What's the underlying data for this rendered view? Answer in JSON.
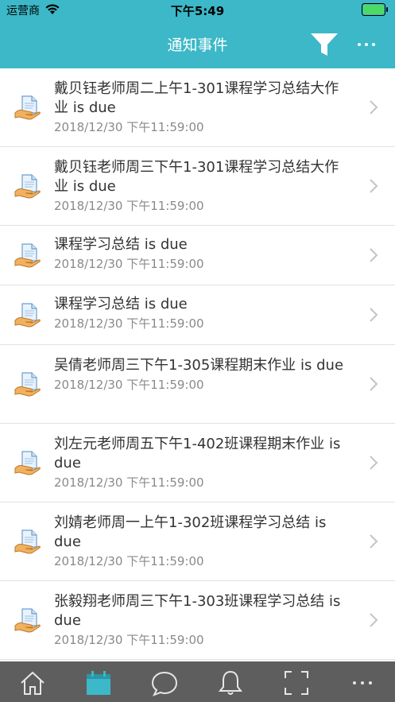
{
  "status_bar": {
    "carrier": "运营商",
    "time": "下午5:49",
    "battery_color": "#4cd964"
  },
  "nav": {
    "title": "通知事件",
    "background": "#3cb8c8"
  },
  "events": [
    {
      "title": "戴贝钰老师周二上午1-301课程学习总结大作业 is due",
      "date": "2018/12/30 下午11:59:00"
    },
    {
      "title": "戴贝钰老师周三下午1-301课程学习总结大作业 is due",
      "date": "2018/12/30 下午11:59:00"
    },
    {
      "title": "课程学习总结 is due",
      "date": "2018/12/30 下午11:59:00"
    },
    {
      "title": "课程学习总结 is due",
      "date": "2018/12/30 下午11:59:00"
    },
    {
      "title": "吴倩老师周三下午1-305课程期末作业 is due",
      "date": "2018/12/30 下午11:59:00"
    },
    {
      "title": "刘左元老师周五下午1-402班课程期末作业 is due",
      "date": "2018/12/30 下午11:59:00"
    },
    {
      "title": "刘婧老师周一上午1-302班课程学习总结 is due",
      "date": "2018/12/30 下午11:59:00"
    },
    {
      "title": "张毅翔老师周三下午1-303班课程学习总结 is due",
      "date": "2018/12/30 下午11:59:00"
    }
  ],
  "tab_bar": {
    "background": "#5e5e5e",
    "active_color": "#3cb8c8",
    "icons": [
      "home-icon",
      "calendar-icon",
      "chat-icon",
      "bell-icon",
      "scan-icon",
      "more-icon"
    ],
    "active_index": 1
  }
}
